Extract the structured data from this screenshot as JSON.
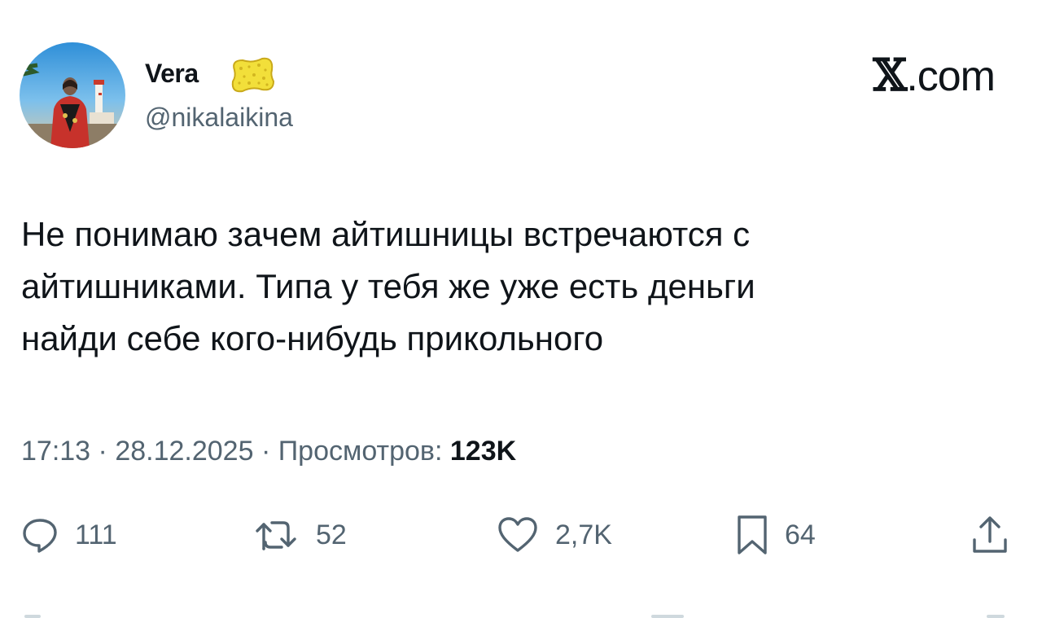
{
  "author": {
    "display_name": "Vera",
    "handle": "@nikalaikina",
    "badge_icon": "sponge-emoji"
  },
  "site": {
    "x_mark": "𝕏",
    "domain": ".com"
  },
  "tweet": {
    "lines": [
      "Не понимаю зачем айтишницы встречаются с",
      "айтишниками. Типа у тебя же уже есть деньги",
      "найди себе кого-нибудь прикольного"
    ]
  },
  "meta": {
    "time": "17:13",
    "separator": "·",
    "date": "28.12.2025",
    "views_label": "Просмотров:",
    "views_count": "123K"
  },
  "actions": {
    "replies": "111",
    "reposts": "52",
    "likes": "2,7K",
    "bookmarks": "64"
  },
  "colors": {
    "text": "#0f1419",
    "secondary": "#536471",
    "badge": "#f2df3a"
  }
}
